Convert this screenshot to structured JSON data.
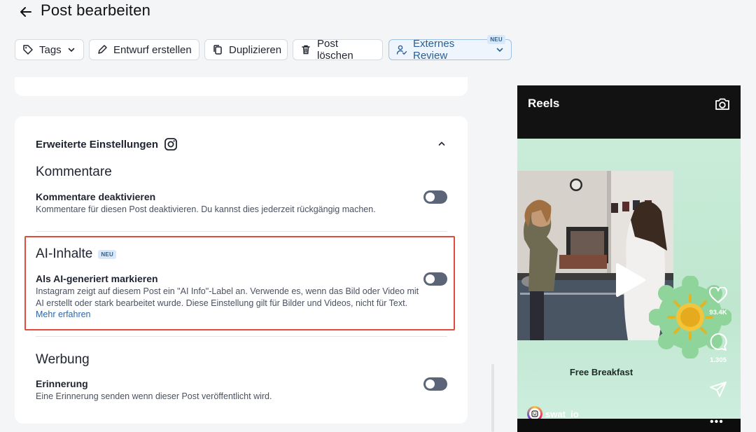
{
  "header": {
    "title": "Post bearbeiten"
  },
  "toolbar": {
    "tags_label": "Tags",
    "draft_label": "Entwurf erstellen",
    "duplicate_label": "Duplizieren",
    "delete_label": "Post löschen",
    "review_label": "Externes Review",
    "review_badge": "NEU"
  },
  "advanced": {
    "title": "Erweiterte Einstellungen",
    "sections": {
      "comments": {
        "heading": "Kommentare",
        "setting_title": "Kommentare deaktivieren",
        "setting_desc": "Kommentare für diesen Post deaktivieren. Du kannst dies jederzeit rückgängig machen.",
        "enabled": false
      },
      "ai": {
        "heading": "AI-Inhalte",
        "badge": "NEU",
        "setting_title": "Als AI-generiert markieren",
        "setting_desc": "Instagram zeigt auf diesem Post ein \"AI Info\"-Label an. Verwende es, wenn das Bild oder Video mit AI erstellt oder stark bearbeitet wurde. Diese Einstellung gilt für Bilder und Videos, nicht für Text.",
        "learn_more": "Mehr erfahren",
        "enabled": false
      },
      "ads": {
        "heading": "Werbung",
        "setting_title": "Erinnerung",
        "setting_desc": "Eine Erinnerung senden wenn dieser Post veröffentlicht wird.",
        "enabled": false
      }
    }
  },
  "preview": {
    "title": "Reels",
    "caption": "Free Breakfast",
    "likes": "93.4K",
    "comments": "1.305",
    "account": "swat_io",
    "colors": {
      "background": "#c9ecd8",
      "highlight": "#e14b3b"
    }
  }
}
